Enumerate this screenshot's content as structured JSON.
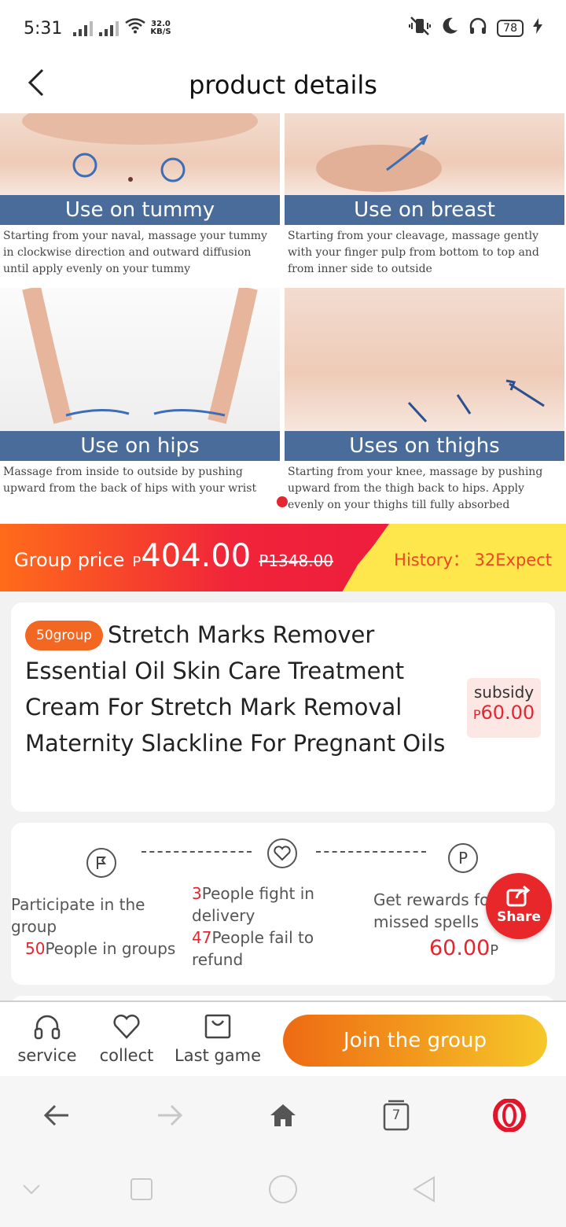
{
  "status_bar": {
    "time": "5:31",
    "net_speed": "32.0",
    "net_unit": "KB/S",
    "battery": "78"
  },
  "header": {
    "title": "product details"
  },
  "image_panels": [
    {
      "banner": "Use on tummy",
      "desc": "Starting from your naval, massage your tummy in clockwise direction and outward diffusion until apply evenly on your tummy"
    },
    {
      "banner": "Use on breast",
      "desc": "Starting from your cleavage, massage gently with your finger pulp from bottom to top and from inner side to outside"
    },
    {
      "banner": "Use on hips",
      "desc": "Massage from inside to outside by pushing upward from the back of hips with your wrist"
    },
    {
      "banner": "Uses on thighs",
      "desc": "Starting from your knee, massage by pushing upward from the thigh back to hips. Apply evenly on your thighs till fully absorbed"
    }
  ],
  "price": {
    "label": "Group price",
    "currency": "P",
    "current": "404.00",
    "original": "P1348.00",
    "history": "History： 32Expect"
  },
  "product": {
    "badge": "50group",
    "title": "Stretch Marks Remover Essential Oil Skin Care Treatment Cream For Stretch Mark Removal Maternity Slackline For Pregnant Oils",
    "subsidy_label": "subsidy",
    "subsidy_currency": "P",
    "subsidy_value": "60.00"
  },
  "steps": {
    "step1_line1": "Participate in the group",
    "step1_count": "50",
    "step1_suffix": "People in groups",
    "step2_count1": "3",
    "step2_text1": "People fight in delivery",
    "step2_count2": "47",
    "step2_text2": "People fail to refund",
    "step3_text": "Get rewards for missed spells",
    "step3_amount": "60.00",
    "step3_currency": "P",
    "step3_icon_letter": "P"
  },
  "share": {
    "label": "Share"
  },
  "action_bar": {
    "service": "service",
    "collect": "collect",
    "last_game": "Last game",
    "join": "Join the group"
  },
  "browser": {
    "tab_count": "7"
  },
  "colors": {
    "accent_red": "#e3262f",
    "accent_orange": "#f26722",
    "banner_blue": "#4a6c9b",
    "price_yellow": "#fde74c"
  }
}
